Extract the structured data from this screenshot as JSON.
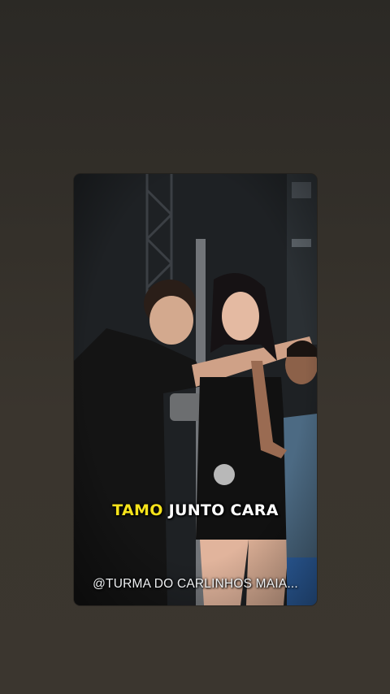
{
  "video": {
    "caption_highlight": "TAMO",
    "caption_rest": "JUNTO CARA",
    "watermark": "@TURMA DO CARLINHOS MAIA..."
  },
  "colors": {
    "caption_highlight": "#f5e21b",
    "caption_text": "#ffffff",
    "background": "#36322c"
  }
}
